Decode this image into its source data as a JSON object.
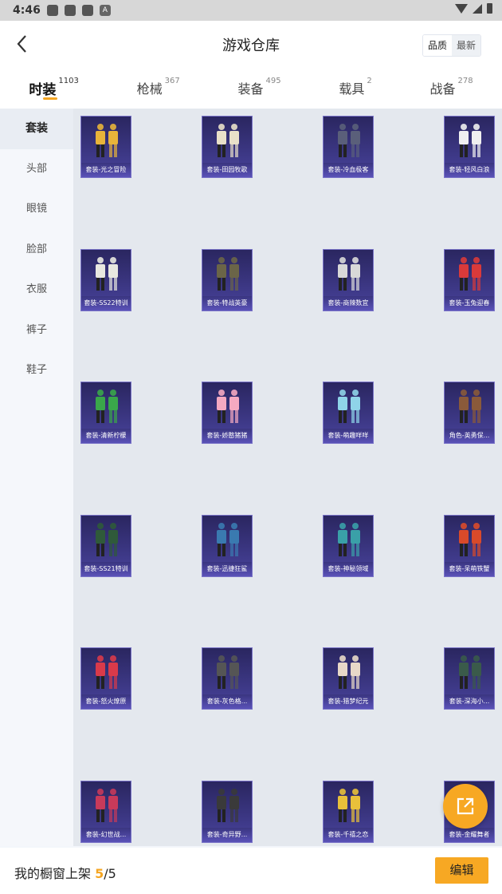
{
  "status": {
    "time": "4:46",
    "notif_a": "A"
  },
  "header": {
    "title": "游戏仓库",
    "sort_options": [
      "品质",
      "最新"
    ]
  },
  "tabs": [
    {
      "label": "时装",
      "count": "1103"
    },
    {
      "label": "枪械",
      "count": "367"
    },
    {
      "label": "装备",
      "count": "495"
    },
    {
      "label": "载具",
      "count": "2"
    },
    {
      "label": "战备",
      "count": "278"
    }
  ],
  "sidebar": [
    "套装",
    "头部",
    "眼镜",
    "脸部",
    "衣服",
    "裤子",
    "鞋子"
  ],
  "items": [
    {
      "caption": "套装-光之冒险",
      "color": "#e8b43a"
    },
    {
      "caption": "套装-田园牧歌",
      "color": "#e9e0c9"
    },
    {
      "caption": "套装-冷血极客",
      "color": "#5a5f7a"
    },
    {
      "caption": "套装-轻风白浪",
      "color": "#f0f0f0"
    },
    {
      "caption": "套装-SS22特训",
      "color": "#e8e8e0"
    },
    {
      "caption": "套装-特战英豪",
      "color": "#6b6548"
    },
    {
      "caption": "套装-商辣数宜",
      "color": "#d8d8d8"
    },
    {
      "caption": "套装-玉兔迎春",
      "color": "#d93a3a"
    },
    {
      "caption": "套装-清新柠檬",
      "color": "#3aa74a"
    },
    {
      "caption": "套装-娇憨猪猪",
      "color": "#f5a9c1"
    },
    {
      "caption": "套装-萌趣咩咩",
      "color": "#8fd4e8"
    },
    {
      "caption": "角色-英勇保...",
      "color": "#8a5a3a"
    },
    {
      "caption": "套装-SS21特训",
      "color": "#2f5a3a"
    },
    {
      "caption": "套装-迅捷狂鲨",
      "color": "#3a7ab0"
    },
    {
      "caption": "套装-神秘领域",
      "color": "#3aa0a8"
    },
    {
      "caption": "套装-呆萌铁蟹",
      "color": "#d94a2a"
    },
    {
      "caption": "套装-怒火燎原",
      "color": "#d93a4a"
    },
    {
      "caption": "套装-灰色格...",
      "color": "#555555"
    },
    {
      "caption": "套装-猎梦纪元",
      "color": "#e8d8c8"
    },
    {
      "caption": "套装-深海小...",
      "color": "#3a5a4a"
    },
    {
      "caption": "套装-幻世战...",
      "color": "#c83a5a"
    },
    {
      "caption": "套装-奇异野...",
      "color": "#3a3a3a"
    },
    {
      "caption": "套装-千禧之恋",
      "color": "#e8c03a"
    },
    {
      "caption": "套装-金耀舞者",
      "color": "#c8a030"
    }
  ],
  "bottom": {
    "label": "我的橱窗上架 ",
    "current": "5",
    "separator": "/",
    "total": "5",
    "edit_label": "编辑"
  },
  "icons": {
    "back": "back-chevron-icon",
    "share": "share-external-icon"
  },
  "accent": "#f7a823"
}
